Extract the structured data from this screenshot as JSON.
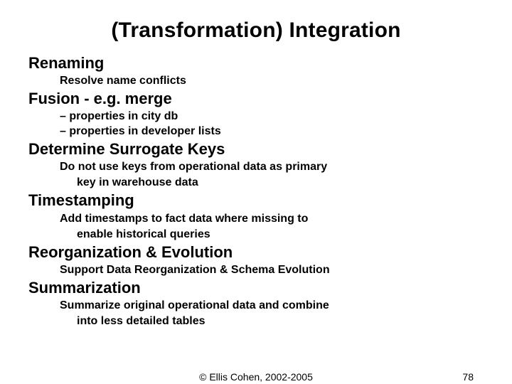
{
  "title": "(Transformation) Integration",
  "sections": [
    {
      "heading": "Renaming",
      "lines": [
        {
          "text": "Resolve name conflicts",
          "type": "sub"
        }
      ]
    },
    {
      "heading": "Fusion - e.g. merge",
      "lines": [
        {
          "text": "– properties in city db",
          "type": "bullet"
        },
        {
          "text": "– properties in developer lists",
          "type": "bullet"
        }
      ]
    },
    {
      "heading": "Determine Surrogate Keys",
      "lines": [
        {
          "text": "Do not use keys from operational data as primary",
          "type": "sub"
        },
        {
          "text": "key in warehouse data",
          "type": "cont"
        }
      ]
    },
    {
      "heading": "Timestamping",
      "lines": [
        {
          "text": "Add timestamps to fact data where missing to",
          "type": "sub"
        },
        {
          "text": "enable historical queries",
          "type": "cont"
        }
      ]
    },
    {
      "heading": "Reorganization & Evolution",
      "lines": [
        {
          "text": "Support Data Reorganization & Schema Evolution",
          "type": "sub"
        }
      ]
    },
    {
      "heading": "Summarization",
      "lines": [
        {
          "text": "Summarize original operational data and combine",
          "type": "sub"
        },
        {
          "text": "into less detailed tables",
          "type": "cont"
        }
      ]
    }
  ],
  "footer": {
    "copyright": "© Ellis Cohen, 2002-2005",
    "page": "78"
  }
}
